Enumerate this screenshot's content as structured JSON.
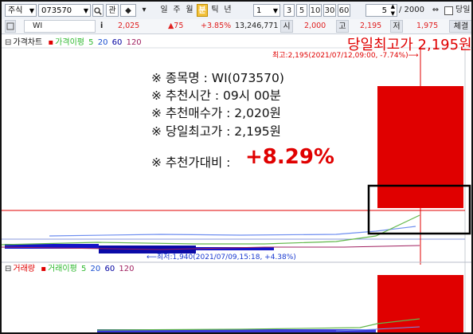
{
  "toolbar": {
    "market": "주식",
    "code": "073570",
    "btn_gwan": "관",
    "periods": [
      "일",
      "주",
      "월",
      "분",
      "틱",
      "년"
    ],
    "interval_value": "1",
    "minute_opts": [
      "3",
      "5",
      "10",
      "30",
      "60"
    ],
    "count_left": "5",
    "count_total": "/ 2000",
    "check_label": "당일"
  },
  "quote": {
    "name": "WI",
    "info_icon": "i",
    "price": "2,025",
    "change": "▲75",
    "change_pct": "+3.85%",
    "volume": "13,246,771",
    "open_label": "시",
    "open": "2,000",
    "high_label": "고",
    "high": "2,195",
    "low_label": "저",
    "low": "1,975",
    "exec_label": "체결"
  },
  "price_legend": {
    "title": "가격차트",
    "ma_label": "가격이평",
    "ma5": "5",
    "ma20": "20",
    "ma60": "60",
    "ma120": "120"
  },
  "volume_legend": {
    "title": "거래량",
    "ma_label": "거래이평",
    "ma5": "5",
    "ma20": "20",
    "ma60": "60",
    "ma120": "120"
  },
  "chart": {
    "high_marker": "최고:2,195(2021/07/12,09:00, -7.74%)⟶",
    "low_marker": "⟵최저:1,940(2021/07/09,15:18, +4.38%)"
  },
  "overlay": {
    "headline": "당일최고가 2,195원",
    "line1": "※ 종목명 : WI(073570)",
    "line2": "※ 추천시간 : 09시 00분",
    "line3": "※ 추천매수가 : 2,020원",
    "line4": "※ 당일최고가 : 2,195원",
    "line5_label": "※ 추천가대비 :",
    "line5_value": "+8.29%"
  },
  "colors": {
    "candle_up": "#e00000",
    "ma5": "#2db82d",
    "ma20": "#1a4fd0",
    "ma60": "#0000a0",
    "ma120": "#a02060"
  },
  "chart_data": {
    "type": "line",
    "title": "가격차트",
    "candle_last": {
      "open": 2000,
      "high": 2195,
      "low": 1975,
      "close": 2025
    },
    "volume_last": 13246771
  }
}
